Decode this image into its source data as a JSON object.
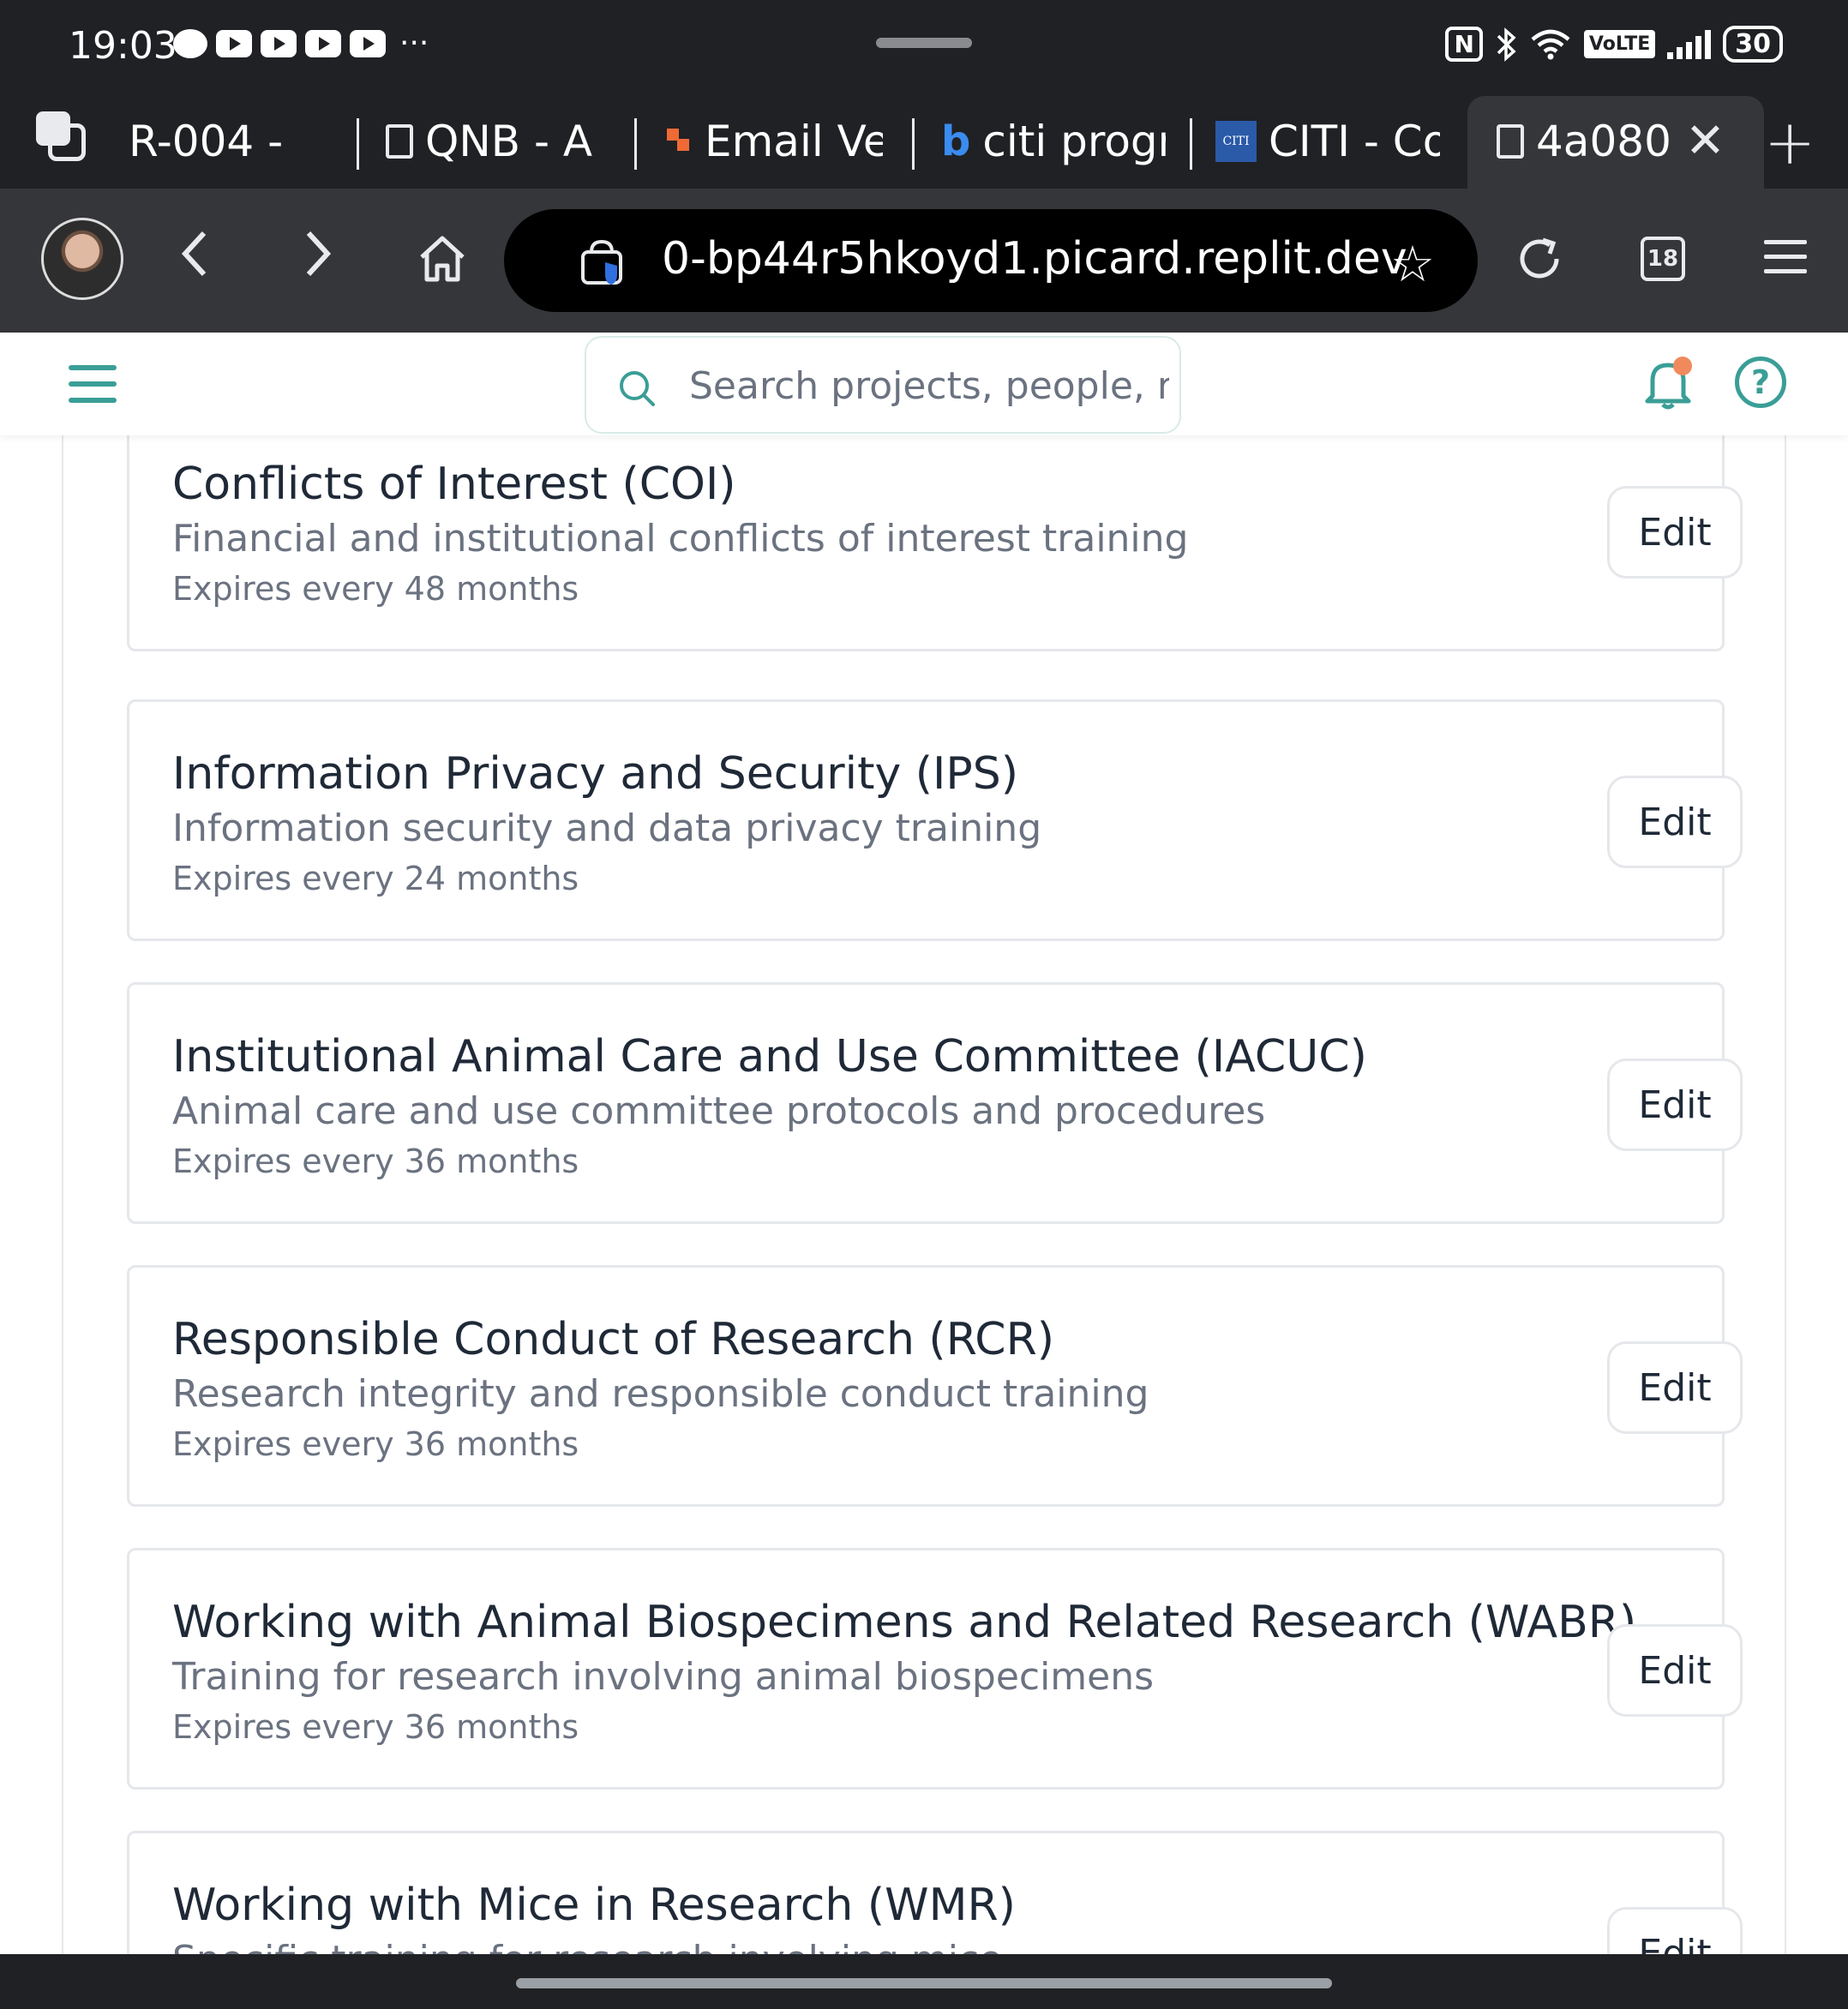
{
  "status_bar": {
    "time": "19:03",
    "dots": "···",
    "nfc": "N",
    "volte": "VoLTE",
    "battery": "30"
  },
  "tabs": [
    {
      "label": "R-004 - "
    },
    {
      "label": "QNB - A"
    },
    {
      "label": "Email Ve"
    },
    {
      "label": "citi progr"
    },
    {
      "label": "CITI - Co"
    },
    {
      "label": "4a080"
    }
  ],
  "tab_citi_favicon": "CITI",
  "toolbar": {
    "url": "0-bp44r5hkoyd1.picard.replit.dev",
    "tab_count": "18"
  },
  "header": {
    "search_placeholder": "Search projects, people, res"
  },
  "trainings": [
    {
      "title": "Conflicts of Interest (COI)",
      "description": "Financial and institutional conflicts of interest training",
      "expires": "Expires every 48 months",
      "edit_label": "Edit"
    },
    {
      "title": "Information Privacy and Security (IPS)",
      "description": "Information security and data privacy training",
      "expires": "Expires every 24 months",
      "edit_label": "Edit"
    },
    {
      "title": "Institutional Animal Care and Use Committee (IACUC)",
      "description": "Animal care and use committee protocols and procedures",
      "expires": "Expires every 36 months",
      "edit_label": "Edit"
    },
    {
      "title": "Responsible Conduct of Research (RCR)",
      "description": "Research integrity and responsible conduct training",
      "expires": "Expires every 36 months",
      "edit_label": "Edit"
    },
    {
      "title": "Working with Animal Biospecimens and Related Research (WABR)",
      "description": "Training for research involving animal biospecimens",
      "expires": "Expires every 36 months",
      "edit_label": "Edit"
    },
    {
      "title": "Working with Mice in Research (WMR)",
      "description": "Specific training for research involving mice",
      "expires": "",
      "edit_label": "Edit"
    }
  ],
  "colors": {
    "accent": "#3a9e96",
    "notification_dot": "#f08a5d",
    "browser_dark": "#202124"
  }
}
